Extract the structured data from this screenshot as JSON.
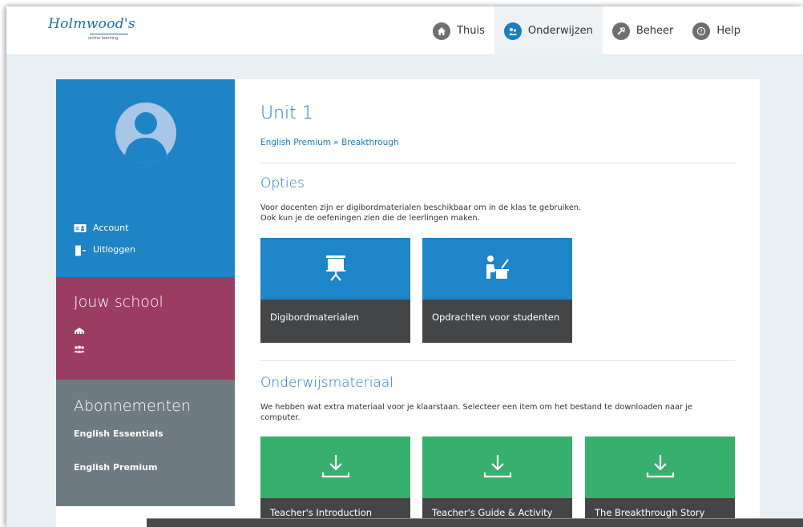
{
  "header": {
    "logo_text": "Holmwood's",
    "logo_subtext": "online learning",
    "nav": [
      {
        "label": "Thuis",
        "icon": "home-icon"
      },
      {
        "label": "Onderwijzen",
        "icon": "teach-icon",
        "active": true
      },
      {
        "label": "Beheer",
        "icon": "tools-icon"
      },
      {
        "label": "Help",
        "icon": "help-icon"
      }
    ]
  },
  "sidebar": {
    "links": [
      {
        "label": "Account",
        "icon": "account-card-icon"
      },
      {
        "label": "Uitloggen",
        "icon": "logout-door-icon"
      }
    ],
    "school": {
      "title": "Jouw school",
      "icons": [
        "school-building-icon",
        "people-group-icon"
      ]
    },
    "subscriptions": {
      "title": "Abonnementen",
      "items": [
        "English Essentials",
        "English Premium"
      ]
    }
  },
  "main": {
    "title": "Unit 1",
    "breadcrumb": "English Premium » Breakthrough",
    "options": {
      "title": "Opties",
      "text_line1": "Voor docenten zijn er digibordmaterialen beschikbaar om in de klas te gebruiken.",
      "text_line2": "Ook kun je de oefeningen zien die de leerlingen maken.",
      "tiles": [
        {
          "label": "Digibordmaterialen",
          "icon": "projector-screen-icon"
        },
        {
          "label": "Opdrachten voor studenten",
          "icon": "student-desk-icon"
        }
      ]
    },
    "materials": {
      "title": "Onderwijsmateriaal",
      "text": "We hebben wat extra materiaal voor je klaarstaan. Selecteer een item om het bestand te downloaden naar je computer.",
      "tiles": [
        {
          "label": "Teacher's Introduction",
          "icon": "download-icon"
        },
        {
          "label": "Teacher's Guide & Activity",
          "icon": "download-icon"
        },
        {
          "label": "The Breakthrough Story",
          "icon": "download-icon"
        }
      ]
    }
  },
  "colors": {
    "brand_blue": "#1f84c6",
    "school_magenta": "#9b3c62",
    "subs_gray": "#6f7b82",
    "tile_green": "#37b06d",
    "tile_dark": "#444546"
  }
}
